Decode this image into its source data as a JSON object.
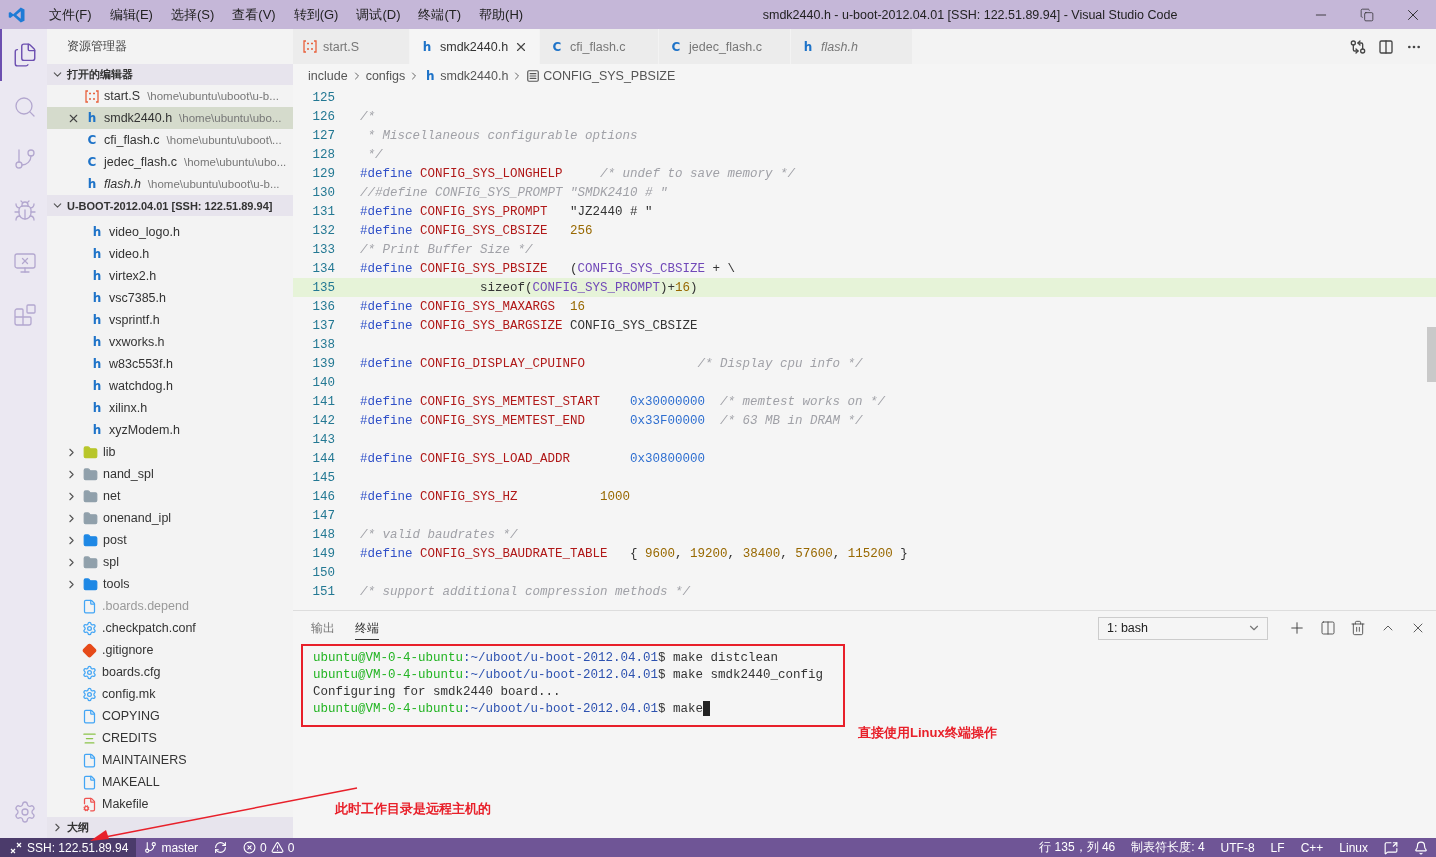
{
  "window": {
    "title": "smdk2440.h - u-boot-2012.04.01 [SSH: 122.51.89.94] - Visual Studio Code"
  },
  "menu": [
    "文件(F)",
    "编辑(E)",
    "选择(S)",
    "查看(V)",
    "转到(G)",
    "调试(D)",
    "终端(T)",
    "帮助(H)"
  ],
  "activity_bar": [
    {
      "kind": "files",
      "selected": true
    },
    {
      "kind": "search",
      "selected": false
    },
    {
      "kind": "git",
      "selected": false
    },
    {
      "kind": "debug",
      "selected": false
    },
    {
      "kind": "remote",
      "selected": false
    },
    {
      "kind": "extensions",
      "selected": false
    }
  ],
  "sidebar": {
    "title": "资源管理器",
    "open_editors": {
      "title": "打开的编辑器",
      "expanded": true,
      "items": [
        {
          "kind": "asm",
          "name": "start.S",
          "path": "\\home\\ubuntu\\uboot\\u-b...",
          "selected": false,
          "italic": false
        },
        {
          "kind": "header",
          "badge": "h",
          "name": "smdk2440.h",
          "path": "\\home\\ubuntu\\ubo...",
          "selected": true,
          "italic": false
        },
        {
          "kind": "header",
          "badge": "C",
          "name": "cfi_flash.c",
          "path": "\\home\\ubuntu\\uboot\\...",
          "selected": false,
          "italic": false
        },
        {
          "kind": "header",
          "badge": "C",
          "name": "jedec_flash.c",
          "path": "\\home\\ubuntu\\ubo...",
          "selected": false,
          "italic": false
        },
        {
          "kind": "header",
          "badge": "h",
          "name": "flash.h",
          "path": "\\home\\ubuntu\\uboot\\u-b...",
          "selected": false,
          "italic": true
        }
      ]
    },
    "project": {
      "title": "U-BOOT-2012.04.01 [SSH: 122.51.89.94]",
      "expanded": true,
      "items": [
        {
          "kind": "group",
          "children": [
            {
              "kind": "header",
              "badge": "h",
              "name": "video_logo.h",
              "dimmed": false
            },
            {
              "kind": "header",
              "badge": "h",
              "name": "video.h",
              "dimmed": false
            },
            {
              "kind": "header",
              "badge": "h",
              "name": "virtex2.h",
              "dimmed": false
            },
            {
              "kind": "header",
              "badge": "h",
              "name": "vsc7385.h",
              "dimmed": false
            },
            {
              "kind": "header",
              "badge": "h",
              "name": "vsprintf.h",
              "dimmed": false
            },
            {
              "kind": "header",
              "badge": "h",
              "name": "vxworks.h",
              "dimmed": false
            },
            {
              "kind": "header",
              "badge": "h",
              "name": "w83c553f.h",
              "dimmed": false
            },
            {
              "kind": "header",
              "badge": "h",
              "name": "watchdog.h",
              "dimmed": false
            },
            {
              "kind": "header",
              "badge": "h",
              "name": "xilinx.h",
              "dimmed": false
            },
            {
              "kind": "header",
              "badge": "h",
              "name": "xyzModem.h",
              "dimmed": false
            }
          ]
        },
        {
          "kind": "folder-lib",
          "name": "lib",
          "expanded": false,
          "dimmed": false
        },
        {
          "kind": "folder",
          "name": "nand_spl",
          "expanded": false,
          "dimmed": false
        },
        {
          "kind": "folder",
          "name": "net",
          "expanded": false,
          "dimmed": false
        },
        {
          "kind": "folder",
          "name": "onenand_ipl",
          "expanded": false,
          "dimmed": false
        },
        {
          "kind": "folder-blue",
          "name": "post",
          "expanded": false,
          "dimmed": false
        },
        {
          "kind": "folder",
          "name": "spl",
          "expanded": false,
          "dimmed": false
        },
        {
          "kind": "folder-blue",
          "name": "tools",
          "expanded": false,
          "dimmed": false
        },
        {
          "kind": "file",
          "name": ".boards.depend",
          "dimmed": true
        },
        {
          "kind": "gear",
          "name": ".checkpatch.conf",
          "dimmed": false
        },
        {
          "kind": "git",
          "name": ".gitignore",
          "dimmed": false
        },
        {
          "kind": "gear",
          "name": "boards.cfg",
          "dimmed": false
        },
        {
          "kind": "gear",
          "name": "config.mk",
          "dimmed": false
        },
        {
          "kind": "file",
          "name": "COPYING",
          "dimmed": false
        },
        {
          "kind": "lines",
          "name": "CREDITS",
          "dimmed": false
        },
        {
          "kind": "file",
          "name": "MAINTAINERS",
          "dimmed": false
        },
        {
          "kind": "file",
          "name": "MAKEALL",
          "dimmed": false
        },
        {
          "kind": "make",
          "name": "Makefile",
          "dimmed": false
        }
      ]
    },
    "outline": {
      "title": "大纲",
      "expanded": false
    }
  },
  "tabs": [
    {
      "kind": "asm",
      "label": "start.S",
      "selected": false,
      "italic": false
    },
    {
      "kind": "header",
      "badge": "h",
      "label": "smdk2440.h",
      "selected": true,
      "italic": false
    },
    {
      "kind": "header",
      "badge": "C",
      "label": "cfi_flash.c",
      "selected": false,
      "italic": false
    },
    {
      "kind": "header",
      "badge": "C",
      "label": "jedec_flash.c",
      "selected": false,
      "italic": false
    },
    {
      "kind": "header",
      "badge": "h",
      "label": "flash.h",
      "selected": false,
      "italic": true
    }
  ],
  "breadcrumbs": [
    {
      "kind": "folder",
      "label": "include"
    },
    {
      "kind": "folder",
      "label": "configs"
    },
    {
      "kind": "header",
      "badge": "h",
      "label": "smdk2440.h"
    },
    {
      "kind": "symbol",
      "label": "CONFIG_SYS_PBSIZE"
    }
  ],
  "code": [
    {
      "number": "125",
      "current": false
    },
    {
      "number": "126",
      "current": false,
      "tokens": [
        {
          "kind": "comment",
          "text": "/*"
        }
      ]
    },
    {
      "number": "127",
      "current": false,
      "tokens": [
        {
          "kind": "comment",
          "text": " * Miscellaneous configurable options"
        }
      ]
    },
    {
      "number": "128",
      "current": false,
      "tokens": [
        {
          "kind": "comment",
          "text": " */"
        }
      ]
    },
    {
      "number": "129",
      "current": false,
      "tokens": [
        {
          "kind": "keyword",
          "text": "#define "
        },
        {
          "kind": "macro",
          "text": "CONFIG_SYS_LONGHELP"
        },
        {
          "kind": "comment",
          "text": "     /* undef to save memory */"
        }
      ]
    },
    {
      "number": "130",
      "current": false,
      "tokens": [
        {
          "kind": "comment",
          "text": "//#define CONFIG_SYS_PROMPT \"SMDK2410 # \""
        }
      ]
    },
    {
      "number": "131",
      "current": false,
      "tokens": [
        {
          "kind": "keyword",
          "text": "#define "
        },
        {
          "kind": "macro",
          "text": "CONFIG_SYS_PROMPT"
        },
        {
          "kind": "string",
          "text": "   \"JZ2440 # \""
        }
      ]
    },
    {
      "number": "132",
      "current": false,
      "tokens": [
        {
          "kind": "keyword",
          "text": "#define "
        },
        {
          "kind": "macro",
          "text": "CONFIG_SYS_CBSIZE"
        },
        {
          "kind": "number",
          "text": "   256"
        }
      ]
    },
    {
      "number": "133",
      "current": false,
      "tokens": [
        {
          "kind": "comment",
          "text": "/* Print Buffer Size */"
        }
      ]
    },
    {
      "number": "134",
      "current": false,
      "tokens": [
        {
          "kind": "keyword",
          "text": "#define "
        },
        {
          "kind": "macro",
          "text": "CONFIG_SYS_PBSIZE"
        },
        {
          "kind": "plain",
          "text": "   ("
        },
        {
          "kind": "ref",
          "text": "CONFIG_SYS_CBSIZE"
        },
        {
          "kind": "plain",
          "text": " + \\"
        }
      ]
    },
    {
      "number": "135",
      "current": true,
      "tokens": [
        {
          "kind": "plain",
          "text": "                sizeof("
        },
        {
          "kind": "ref",
          "text": "CONFIG_SYS_PROMPT"
        },
        {
          "kind": "plain",
          "text": ")+"
        },
        {
          "kind": "number",
          "text": "16"
        },
        {
          "kind": "plain",
          "text": ")"
        }
      ]
    },
    {
      "number": "136",
      "current": false,
      "tokens": [
        {
          "kind": "keyword",
          "text": "#define "
        },
        {
          "kind": "macro",
          "text": "CONFIG_SYS_MAXARGS"
        },
        {
          "kind": "number",
          "text": "  16"
        }
      ]
    },
    {
      "number": "137",
      "current": false,
      "tokens": [
        {
          "kind": "keyword",
          "text": "#define "
        },
        {
          "kind": "macro",
          "text": "CONFIG_SYS_BARGSIZE"
        },
        {
          "kind": "plain",
          "text": " CONFIG_SYS_CBSIZE"
        }
      ]
    },
    {
      "number": "138",
      "current": false
    },
    {
      "number": "139",
      "current": false,
      "tokens": [
        {
          "kind": "keyword",
          "text": "#define "
        },
        {
          "kind": "macro",
          "text": "CONFIG_DISPLAY_CPUINFO"
        },
        {
          "kind": "comment",
          "text": "               /* Display cpu info */"
        }
      ]
    },
    {
      "number": "140",
      "current": false
    },
    {
      "number": "141",
      "current": false,
      "tokens": [
        {
          "kind": "keyword",
          "text": "#define "
        },
        {
          "kind": "macro",
          "text": "CONFIG_SYS_MEMTEST_START"
        },
        {
          "kind": "hex",
          "text": "    0x30000000"
        },
        {
          "kind": "comment",
          "text": "  /* memtest works on */"
        }
      ]
    },
    {
      "number": "142",
      "current": false,
      "tokens": [
        {
          "kind": "keyword",
          "text": "#define "
        },
        {
          "kind": "macro",
          "text": "CONFIG_SYS_MEMTEST_END"
        },
        {
          "kind": "hex",
          "text": "      0x33F00000"
        },
        {
          "kind": "comment",
          "text": "  /* 63 MB in DRAM */"
        }
      ]
    },
    {
      "number": "143",
      "current": false
    },
    {
      "number": "144",
      "current": false,
      "tokens": [
        {
          "kind": "keyword",
          "text": "#define "
        },
        {
          "kind": "macro",
          "text": "CONFIG_SYS_LOAD_ADDR"
        },
        {
          "kind": "hex",
          "text": "        0x30800000"
        }
      ]
    },
    {
      "number": "145",
      "current": false
    },
    {
      "number": "146",
      "current": false,
      "tokens": [
        {
          "kind": "keyword",
          "text": "#define "
        },
        {
          "kind": "macro",
          "text": "CONFIG_SYS_HZ"
        },
        {
          "kind": "number",
          "text": "           1000"
        }
      ]
    },
    {
      "number": "147",
      "current": false
    },
    {
      "number": "148",
      "current": false,
      "tokens": [
        {
          "kind": "comment",
          "text": "/* valid baudrates */"
        }
      ]
    },
    {
      "number": "149",
      "current": false,
      "tokens": [
        {
          "kind": "keyword",
          "text": "#define "
        },
        {
          "kind": "macro",
          "text": "CONFIG_SYS_BAUDRATE_TABLE"
        },
        {
          "kind": "plain",
          "text": "   { "
        },
        {
          "kind": "number",
          "text": "9600"
        },
        {
          "kind": "plain",
          "text": ", "
        },
        {
          "kind": "number",
          "text": "19200"
        },
        {
          "kind": "plain",
          "text": ", "
        },
        {
          "kind": "number",
          "text": "38400"
        },
        {
          "kind": "plain",
          "text": ", "
        },
        {
          "kind": "number",
          "text": "57600"
        },
        {
          "kind": "plain",
          "text": ", "
        },
        {
          "kind": "number",
          "text": "115200"
        },
        {
          "kind": "plain",
          "text": " }"
        }
      ]
    },
    {
      "number": "150",
      "current": false
    },
    {
      "number": "151",
      "current": false,
      "tokens": [
        {
          "kind": "comment",
          "text": "/* support additional compression methods */"
        }
      ]
    }
  ],
  "panel": {
    "tabs": [
      {
        "label": "输出",
        "selected": false
      },
      {
        "label": "终端",
        "selected": true
      }
    ],
    "terminal_select": {
      "value": "1: bash"
    },
    "lines": [
      {
        "kind": "prompt",
        "user": "ubuntu@VM-0-4-ubuntu",
        "path": ":~/uboot/u-boot-2012.04.01",
        "command": "$ make distclean",
        "cursor": false
      },
      {
        "kind": "prompt",
        "user": "ubuntu@VM-0-4-ubuntu",
        "path": ":~/uboot/u-boot-2012.04.01",
        "command": "$ make smdk2440_config",
        "cursor": false
      },
      {
        "kind": "output",
        "text": "Configuring for smdk2440 board..."
      },
      {
        "kind": "prompt",
        "user": "ubuntu@VM-0-4-ubuntu",
        "path": ":~/uboot/u-boot-2012.04.01",
        "command": "$ make",
        "cursor": true
      }
    ]
  },
  "annotations": [
    {
      "kind": "terminal",
      "text": "直接使用Linux终端操作"
    },
    {
      "kind": "remote",
      "text": "此时工作目录是远程主机的"
    }
  ],
  "status_bar": {
    "remote": "SSH: 122.51.89.94",
    "branch": "master",
    "errors": "0",
    "warnings": "0",
    "right": [
      "行 135，列 46",
      "制表符长度: 4",
      "UTF-8",
      "LF",
      "C++",
      "Linux"
    ]
  }
}
